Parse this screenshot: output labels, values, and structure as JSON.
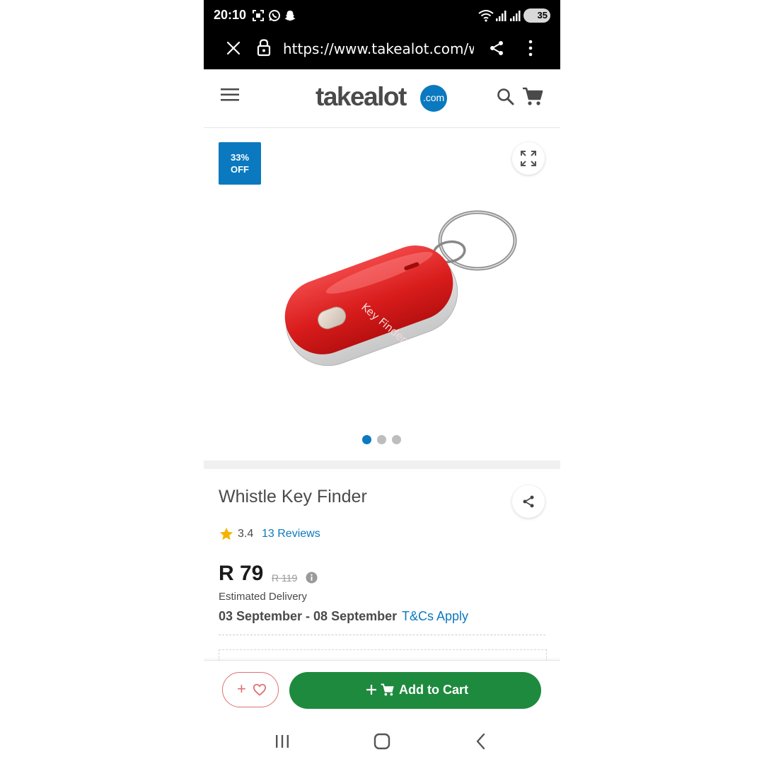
{
  "status_bar": {
    "time": "20:10",
    "battery": "35",
    "notification_icons": [
      "screenshot-icon",
      "whatsapp-icon",
      "snapchat-icon"
    ],
    "system_icons": [
      "wifi-icon",
      "signal-icon",
      "signal-icon",
      "battery-icon"
    ]
  },
  "browser": {
    "url": "https://www.takealot.com/w",
    "icons": [
      "close-icon",
      "lock-icon",
      "share-icon",
      "more-vert-icon"
    ]
  },
  "header": {
    "logo_text": "takealot",
    "logo_badge": ".com",
    "icons": [
      "menu-icon",
      "search-icon",
      "cart-icon"
    ]
  },
  "gallery": {
    "badge_percent": "33%",
    "badge_off": "OFF",
    "image_text": "Key Finder",
    "image_count": 3,
    "active_index": 0
  },
  "product": {
    "title": "Whistle Key Finder",
    "rating": "3.4",
    "reviews_label": "13 Reviews",
    "price": "R 79",
    "old_price": "R 119",
    "delivery_label": "Estimated Delivery",
    "delivery_dates": "03 September - 08 September",
    "tcs_label": "T&Cs Apply"
  },
  "actions": {
    "wishlist_label": "+",
    "add_to_cart_label": "Add to Cart"
  },
  "colors": {
    "brand_blue": "#0b79bf",
    "cart_green": "#1e8a3e",
    "wishlist_red": "#e07070",
    "product_red": "#d92424",
    "star_yellow": "#f5b301"
  },
  "nav_bar": {
    "icons": [
      "recent-apps-icon",
      "home-icon",
      "back-icon"
    ]
  }
}
